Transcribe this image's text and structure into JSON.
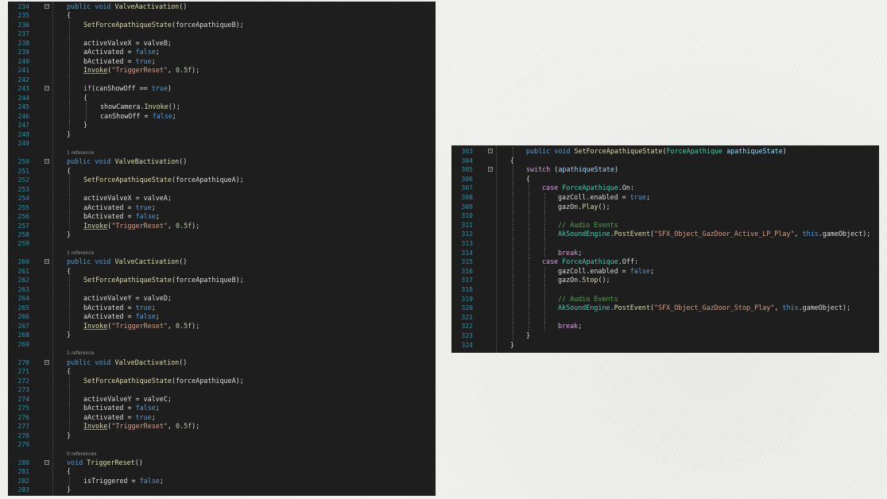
{
  "left_panel": {
    "lines": [
      {
        "n": "234",
        "fold": true,
        "indent": 0,
        "tokens": [
          [
            "kw",
            "public void "
          ],
          [
            "fn",
            "ValveAactivation"
          ],
          [
            "",
            "()"
          ]
        ]
      },
      {
        "n": "235",
        "indent": 0,
        "tokens": [
          [
            "",
            "{"
          ]
        ]
      },
      {
        "n": "236",
        "indent": 1,
        "tokens": [
          [
            "fn",
            "SetForceApathiqueState"
          ],
          [
            "",
            "(forceApathiqueB);"
          ]
        ]
      },
      {
        "n": "237",
        "indent": 1,
        "tokens": []
      },
      {
        "n": "238",
        "indent": 1,
        "tokens": [
          [
            "",
            "activeValveX = valveB;"
          ]
        ]
      },
      {
        "n": "239",
        "indent": 1,
        "tokens": [
          [
            "",
            "aActivated = "
          ],
          [
            "kw",
            "false"
          ],
          [
            "",
            ";"
          ]
        ]
      },
      {
        "n": "240",
        "indent": 1,
        "tokens": [
          [
            "",
            "bActivated = "
          ],
          [
            "kw",
            "true"
          ],
          [
            "",
            ";"
          ]
        ]
      },
      {
        "n": "241",
        "indent": 1,
        "tokens": [
          [
            "fn ul",
            "Invoke"
          ],
          [
            "",
            "("
          ],
          [
            "str",
            "\"TriggerReset\""
          ],
          [
            "",
            ", "
          ],
          [
            "num",
            "0.5f"
          ],
          [
            "",
            ");"
          ]
        ]
      },
      {
        "n": "242",
        "indent": 1,
        "tokens": []
      },
      {
        "n": "243",
        "fold": true,
        "indent": 1,
        "tokens": [
          [
            "kw2",
            "if"
          ],
          [
            "",
            "(canShowOff == "
          ],
          [
            "kw",
            "true"
          ],
          [
            "",
            ")"
          ]
        ]
      },
      {
        "n": "244",
        "indent": 1,
        "tokens": [
          [
            "",
            "{"
          ]
        ]
      },
      {
        "n": "245",
        "indent": 2,
        "tokens": [
          [
            "",
            "showCamera."
          ],
          [
            "fn",
            "Invoke"
          ],
          [
            "",
            "();"
          ]
        ]
      },
      {
        "n": "246",
        "indent": 2,
        "tokens": [
          [
            "",
            "canShowOff = "
          ],
          [
            "kw",
            "false"
          ],
          [
            "",
            ";"
          ]
        ]
      },
      {
        "n": "247",
        "indent": 1,
        "tokens": [
          [
            "",
            "}"
          ]
        ]
      },
      {
        "n": "248",
        "indent": 0,
        "tokens": [
          [
            "",
            "}"
          ]
        ]
      },
      {
        "n": "249",
        "indent": 0,
        "tokens": []
      },
      {
        "n": "",
        "ref": true,
        "indent": 0,
        "tokens": [
          [
            "",
            "1 reference"
          ]
        ]
      },
      {
        "n": "250",
        "fold": true,
        "indent": 0,
        "tokens": [
          [
            "kw",
            "public void "
          ],
          [
            "fn",
            "ValveBactivation"
          ],
          [
            "",
            "()"
          ]
        ]
      },
      {
        "n": "251",
        "indent": 0,
        "tokens": [
          [
            "",
            "{"
          ]
        ]
      },
      {
        "n": "252",
        "indent": 1,
        "tokens": [
          [
            "fn",
            "SetForceApathiqueState"
          ],
          [
            "",
            "(forceApathiqueA);"
          ]
        ]
      },
      {
        "n": "253",
        "indent": 1,
        "tokens": []
      },
      {
        "n": "254",
        "indent": 1,
        "tokens": [
          [
            "",
            "activeValveX = valveA;"
          ]
        ]
      },
      {
        "n": "255",
        "indent": 1,
        "tokens": [
          [
            "",
            "aActivated = "
          ],
          [
            "kw",
            "true"
          ],
          [
            "",
            ";"
          ]
        ]
      },
      {
        "n": "256",
        "indent": 1,
        "tokens": [
          [
            "",
            "bActivated = "
          ],
          [
            "kw",
            "false"
          ],
          [
            "",
            ";"
          ]
        ]
      },
      {
        "n": "257",
        "indent": 1,
        "tokens": [
          [
            "fn ul",
            "Invoke"
          ],
          [
            "",
            "("
          ],
          [
            "str",
            "\"TriggerReset\""
          ],
          [
            "",
            ", "
          ],
          [
            "num",
            "0.5f"
          ],
          [
            "",
            ");"
          ]
        ]
      },
      {
        "n": "258",
        "indent": 0,
        "tokens": [
          [
            "",
            "}"
          ]
        ]
      },
      {
        "n": "259",
        "indent": 0,
        "tokens": []
      },
      {
        "n": "",
        "ref": true,
        "indent": 0,
        "tokens": [
          [
            "",
            "1 reference"
          ]
        ]
      },
      {
        "n": "260",
        "fold": true,
        "indent": 0,
        "tokens": [
          [
            "kw",
            "public void "
          ],
          [
            "fn",
            "ValveCactivation"
          ],
          [
            "",
            "()"
          ]
        ]
      },
      {
        "n": "261",
        "indent": 0,
        "tokens": [
          [
            "",
            "{"
          ]
        ]
      },
      {
        "n": "262",
        "indent": 1,
        "tokens": [
          [
            "fn",
            "SetForceApathiqueState"
          ],
          [
            "",
            "(forceApathiqueB);"
          ]
        ]
      },
      {
        "n": "263",
        "indent": 1,
        "tokens": []
      },
      {
        "n": "264",
        "indent": 1,
        "tokens": [
          [
            "",
            "activeValveY = valveD;"
          ]
        ]
      },
      {
        "n": "265",
        "indent": 1,
        "tokens": [
          [
            "",
            "bActivated = "
          ],
          [
            "kw",
            "true"
          ],
          [
            "",
            ";"
          ]
        ]
      },
      {
        "n": "266",
        "indent": 1,
        "tokens": [
          [
            "",
            "aActivated = "
          ],
          [
            "kw",
            "false"
          ],
          [
            "",
            ";"
          ]
        ]
      },
      {
        "n": "267",
        "indent": 1,
        "tokens": [
          [
            "fn ul",
            "Invoke"
          ],
          [
            "",
            "("
          ],
          [
            "str",
            "\"TriggerReset\""
          ],
          [
            "",
            ", "
          ],
          [
            "num",
            "0.5f"
          ],
          [
            "",
            ");"
          ]
        ]
      },
      {
        "n": "268",
        "indent": 0,
        "tokens": [
          [
            "",
            "}"
          ]
        ]
      },
      {
        "n": "269",
        "indent": 0,
        "tokens": []
      },
      {
        "n": "",
        "ref": true,
        "indent": 0,
        "tokens": [
          [
            "",
            "1 reference"
          ]
        ]
      },
      {
        "n": "270",
        "fold": true,
        "indent": 0,
        "tokens": [
          [
            "kw",
            "public void "
          ],
          [
            "fn",
            "ValveDactivation"
          ],
          [
            "",
            "()"
          ]
        ]
      },
      {
        "n": "271",
        "indent": 0,
        "tokens": [
          [
            "",
            "{"
          ]
        ]
      },
      {
        "n": "272",
        "indent": 1,
        "tokens": [
          [
            "fn",
            "SetForceApathiqueState"
          ],
          [
            "",
            "(forceApathiqueA);"
          ]
        ]
      },
      {
        "n": "273",
        "indent": 1,
        "tokens": []
      },
      {
        "n": "274",
        "indent": 1,
        "tokens": [
          [
            "",
            "activeValveY = valveC;"
          ]
        ]
      },
      {
        "n": "275",
        "indent": 1,
        "tokens": [
          [
            "",
            "bActivated = "
          ],
          [
            "kw",
            "false"
          ],
          [
            "",
            ";"
          ]
        ]
      },
      {
        "n": "276",
        "indent": 1,
        "tokens": [
          [
            "",
            "aActivated = "
          ],
          [
            "kw",
            "true"
          ],
          [
            "",
            ";"
          ]
        ]
      },
      {
        "n": "277",
        "indent": 1,
        "tokens": [
          [
            "fn ul",
            "Invoke"
          ],
          [
            "",
            "("
          ],
          [
            "str",
            "\"TriggerReset\""
          ],
          [
            "",
            ", "
          ],
          [
            "num",
            "0.5f"
          ],
          [
            "",
            ");"
          ]
        ]
      },
      {
        "n": "278",
        "indent": 0,
        "tokens": [
          [
            "",
            "}"
          ]
        ]
      },
      {
        "n": "279",
        "indent": 0,
        "tokens": []
      },
      {
        "n": "",
        "ref": true,
        "indent": 0,
        "tokens": [
          [
            "",
            "0 references"
          ]
        ]
      },
      {
        "n": "280",
        "fold": true,
        "indent": 0,
        "tokens": [
          [
            "kw",
            "void "
          ],
          [
            "fn",
            "TriggerReset"
          ],
          [
            "",
            "()"
          ]
        ]
      },
      {
        "n": "281",
        "indent": 0,
        "tokens": [
          [
            "",
            "{"
          ]
        ]
      },
      {
        "n": "282",
        "indent": 1,
        "tokens": [
          [
            "",
            "isTriggered = "
          ],
          [
            "kw",
            "false"
          ],
          [
            "",
            ";"
          ]
        ]
      },
      {
        "n": "283",
        "indent": 0,
        "tokens": [
          [
            "",
            "}"
          ]
        ]
      }
    ]
  },
  "right_panel": {
    "lines": [
      {
        "n": "303",
        "fold": true,
        "indent": 1,
        "tokens": [
          [
            "kw",
            "public void "
          ],
          [
            "fn",
            "SetForceApathiqueState"
          ],
          [
            "",
            "("
          ],
          [
            "ty",
            "ForceApathique"
          ],
          [
            "",
            " "
          ],
          [
            "par",
            "apathiqueState"
          ],
          [
            "",
            ")"
          ]
        ]
      },
      {
        "n": "304",
        "indent": 0,
        "tokens": [
          [
            "",
            "{"
          ]
        ]
      },
      {
        "n": "305",
        "fold": true,
        "indent": 1,
        "tokens": [
          [
            "kw2",
            "switch"
          ],
          [
            "",
            " ("
          ],
          [
            "par",
            "apathiqueState"
          ],
          [
            "",
            ")"
          ]
        ]
      },
      {
        "n": "306",
        "indent": 1,
        "tokens": [
          [
            "",
            "{"
          ]
        ]
      },
      {
        "n": "307",
        "indent": 2,
        "tokens": [
          [
            "kw2",
            "case "
          ],
          [
            "ty",
            "ForceApathique"
          ],
          [
            "",
            ".On:"
          ]
        ]
      },
      {
        "n": "308",
        "indent": 3,
        "tokens": [
          [
            "",
            "gazColl.enabled = "
          ],
          [
            "kw",
            "true"
          ],
          [
            "",
            ";"
          ]
        ]
      },
      {
        "n": "309",
        "indent": 3,
        "tokens": [
          [
            "",
            "gazOn."
          ],
          [
            "fn",
            "Play"
          ],
          [
            "",
            "();"
          ]
        ]
      },
      {
        "n": "310",
        "indent": 3,
        "tokens": []
      },
      {
        "n": "311",
        "indent": 3,
        "tokens": [
          [
            "cm",
            "// Audio Events"
          ]
        ]
      },
      {
        "n": "312",
        "indent": 3,
        "tokens": [
          [
            "ty",
            "AkSoundEngine"
          ],
          [
            "",
            "."
          ],
          [
            "fn",
            "PostEvent"
          ],
          [
            "",
            "("
          ],
          [
            "str",
            "\"SFX_Object_GazDoor_Active_LP_Play\""
          ],
          [
            "",
            ", "
          ],
          [
            "kw",
            "this"
          ],
          [
            "",
            ".gameObject);"
          ]
        ]
      },
      {
        "n": "313",
        "indent": 3,
        "tokens": []
      },
      {
        "n": "314",
        "indent": 3,
        "tokens": [
          [
            "kw2",
            "break"
          ],
          [
            "",
            ";"
          ]
        ]
      },
      {
        "n": "315",
        "indent": 2,
        "tokens": [
          [
            "kw2",
            "case "
          ],
          [
            "ty",
            "ForceApathique"
          ],
          [
            "",
            ".Off:"
          ]
        ]
      },
      {
        "n": "316",
        "indent": 3,
        "tokens": [
          [
            "",
            "gazColl.enabled = "
          ],
          [
            "kw",
            "false"
          ],
          [
            "",
            ";"
          ]
        ]
      },
      {
        "n": "317",
        "indent": 3,
        "tokens": [
          [
            "",
            "gazOn."
          ],
          [
            "fn",
            "Stop"
          ],
          [
            "",
            "();"
          ]
        ]
      },
      {
        "n": "318",
        "indent": 3,
        "tokens": []
      },
      {
        "n": "319",
        "indent": 3,
        "tokens": [
          [
            "cm",
            "// Audio Events"
          ]
        ]
      },
      {
        "n": "320",
        "indent": 3,
        "tokens": [
          [
            "ty",
            "AkSoundEngine"
          ],
          [
            "",
            "."
          ],
          [
            "fn",
            "PostEvent"
          ],
          [
            "",
            "("
          ],
          [
            "str",
            "\"SFX_Object_GazDoor_Stop_Play\""
          ],
          [
            "",
            ", "
          ],
          [
            "kw",
            "this"
          ],
          [
            "",
            ".gameObject);"
          ]
        ]
      },
      {
        "n": "321",
        "indent": 3,
        "tokens": []
      },
      {
        "n": "322",
        "indent": 3,
        "tokens": [
          [
            "kw2",
            "break"
          ],
          [
            "",
            ";"
          ]
        ]
      },
      {
        "n": "323",
        "indent": 1,
        "tokens": [
          [
            "",
            "}"
          ]
        ]
      },
      {
        "n": "324",
        "indent": 0,
        "tokens": [
          [
            "",
            "}"
          ]
        ]
      }
    ]
  }
}
